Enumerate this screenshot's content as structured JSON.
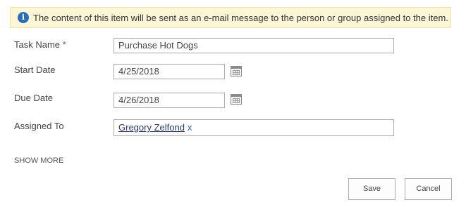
{
  "notice": {
    "icon": "info-icon",
    "text": "The content of this item will be sent as an e-mail message to the person or group assigned to the item."
  },
  "form": {
    "task_name": {
      "label": "Task Name",
      "required_marker": "*",
      "value": "Purchase Hot Dogs"
    },
    "start_date": {
      "label": "Start Date",
      "value": "4/25/2018",
      "icon": "calendar-icon"
    },
    "due_date": {
      "label": "Due Date",
      "value": "4/26/2018",
      "icon": "calendar-icon"
    },
    "assigned_to": {
      "label": "Assigned To",
      "person": "Gregory Zelfond",
      "remove": "x"
    }
  },
  "show_more": "SHOW MORE",
  "buttons": {
    "save": "Save",
    "cancel": "Cancel"
  },
  "colors": {
    "notice_bg": "#fdf6d6",
    "accent": "#2a6ebb",
    "border": "#ababab"
  }
}
